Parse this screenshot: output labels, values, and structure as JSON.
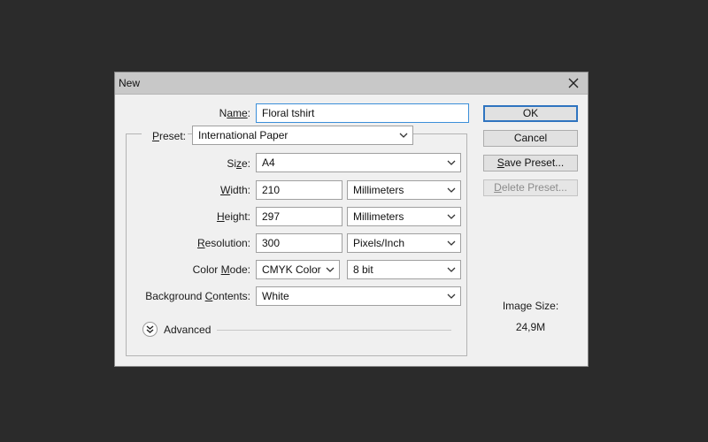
{
  "dialog": {
    "title": "New",
    "close_icon": "close-icon"
  },
  "name": {
    "label_main": "N",
    "label_u": "ame",
    "label_tail": ":",
    "value": "Floral tshirt"
  },
  "preset": {
    "label_u": "P",
    "label_rest": "reset:",
    "value": "International Paper"
  },
  "size": {
    "label_main": "Si",
    "label_u": "z",
    "label_tail": "e:",
    "value": "A4"
  },
  "width": {
    "label_u": "W",
    "label_rest": "idth:",
    "value": "210",
    "unit": "Millimeters"
  },
  "height": {
    "label_u": "H",
    "label_rest": "eight:",
    "value": "297",
    "unit": "Millimeters"
  },
  "resolution": {
    "label_u": "R",
    "label_rest": "esolution:",
    "value": "300",
    "unit": "Pixels/Inch"
  },
  "color_mode": {
    "label_main": "Color ",
    "label_u": "M",
    "label_rest": "ode:",
    "value": "CMYK Color",
    "depth": "8 bit"
  },
  "background": {
    "label_main": "Background ",
    "label_u": "C",
    "label_rest": "ontents:",
    "value": "White"
  },
  "advanced": {
    "label": "Advanced",
    "icon": "double-chevron-down-icon"
  },
  "buttons": {
    "ok": "OK",
    "cancel": "Cancel",
    "save_preset_u": "S",
    "save_preset_rest": "ave Preset...",
    "delete_preset_u": "D",
    "delete_preset_rest": "elete Preset..."
  },
  "image_size": {
    "label": "Image Size:",
    "value": "24,9M"
  },
  "colors": {
    "background": "#2b2b2b",
    "dialog": "#f0f0f0",
    "titlebar": "#c8c8c8",
    "accent": "#2f74c0"
  }
}
